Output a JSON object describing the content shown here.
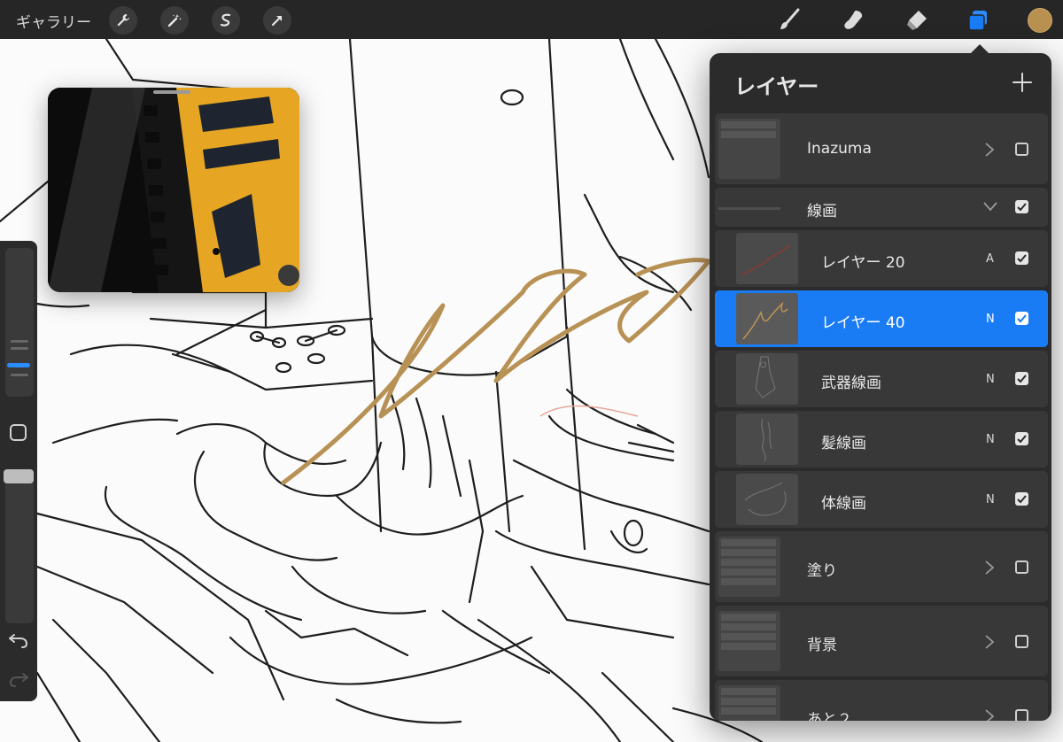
{
  "toolbar": {
    "gallery_label": "ギャラリー",
    "actions": [
      "wrench-icon",
      "magic-wand-icon",
      "selection-icon",
      "transform-arrow-icon"
    ],
    "tools": [
      "brush-icon",
      "smudge-icon",
      "eraser-icon",
      "layers-icon"
    ],
    "current_color": "#b8904f",
    "active_tool_color": "#2a8cff"
  },
  "sidebar": {
    "size_value": 0.18,
    "opacity_value": 1.0
  },
  "layers_panel": {
    "title": "レイヤー",
    "add_symbol": "+",
    "rows": [
      {
        "name": "Inazuma",
        "mode": "",
        "type": "group",
        "expanded": false,
        "visible": false,
        "selected": false
      },
      {
        "name": "線画",
        "mode": "",
        "type": "group",
        "expanded": true,
        "visible": true,
        "selected": false
      },
      {
        "name": "レイヤー 20",
        "mode": "A",
        "type": "layer",
        "visible": true,
        "selected": false
      },
      {
        "name": "レイヤー 40",
        "mode": "N",
        "type": "layer",
        "visible": true,
        "selected": true
      },
      {
        "name": "武器線画",
        "mode": "N",
        "type": "layer",
        "visible": true,
        "selected": false
      },
      {
        "name": "髪線画",
        "mode": "N",
        "type": "layer",
        "visible": true,
        "selected": false
      },
      {
        "name": "体線画",
        "mode": "N",
        "type": "layer",
        "visible": true,
        "selected": false
      },
      {
        "name": "塗り",
        "mode": "",
        "type": "group",
        "expanded": false,
        "visible": false,
        "selected": false
      },
      {
        "name": "背景",
        "mode": "",
        "type": "group",
        "expanded": false,
        "visible": false,
        "selected": false
      },
      {
        "name": "あと２",
        "mode": "",
        "type": "group",
        "expanded": false,
        "visible": false,
        "selected": false
      }
    ]
  },
  "colors": {
    "selected_row": "#1a7cf5",
    "stroke_gold": "#b89155",
    "panel_bg": "#2b2b2b"
  }
}
